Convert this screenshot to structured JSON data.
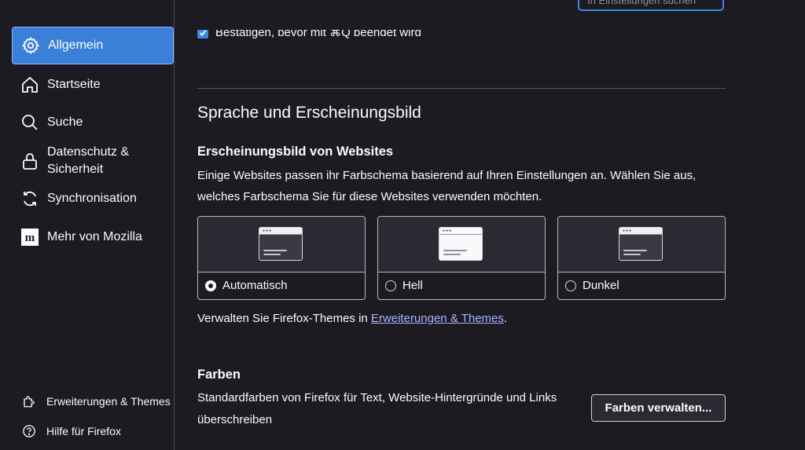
{
  "sidebar": {
    "items": [
      {
        "label": "Allgemein",
        "icon": "gear-icon",
        "selected": true
      },
      {
        "label": "Startseite",
        "icon": "home-icon"
      },
      {
        "label": "Suche",
        "icon": "search-icon"
      },
      {
        "label": "Datenschutz & Sicherheit",
        "line1": "Datenschutz &",
        "line2": "Sicherheit",
        "icon": "lock-icon"
      },
      {
        "label": "Synchronisation",
        "icon": "sync-icon"
      },
      {
        "label": "Mehr von Mozilla",
        "icon": "mozilla-icon"
      }
    ],
    "footer": [
      {
        "label": "Erweiterungen & Themes",
        "icon": "puzzle-icon"
      },
      {
        "label": "Hilfe für Firefox",
        "icon": "help-icon"
      }
    ]
  },
  "search": {
    "placeholder": "In Einstellungen suchen"
  },
  "general": {
    "confirm_quit": {
      "label": "Bestätigen, bevor mit ⌘Q beendet wird",
      "checked": true
    }
  },
  "language_section": {
    "title": "Sprache und Erscheinungsbild",
    "website_appearance": {
      "title": "Erscheinungsbild von Websites",
      "description": "Einige Websites passen ihr Farbschema basierend auf Ihren Einstellungen an. Wählen Sie aus, welches Farbschema Sie für diese Websites verwenden möchten.",
      "options": [
        {
          "label": "Automatisch",
          "selected": true,
          "preview": "dark"
        },
        {
          "label": "Hell",
          "selected": false,
          "preview": "light"
        },
        {
          "label": "Dunkel",
          "selected": false,
          "preview": "dark"
        }
      ],
      "themes_prefix": "Verwalten Sie Firefox-Themes in ",
      "themes_link": "Erweiterungen & Themes",
      "themes_suffix": "."
    }
  },
  "colors_section": {
    "title": "Farben",
    "description": "Standardfarben von Firefox für Text, Website-Hintergründe und Links überschreiben",
    "button_label": "Farben verwalten..."
  },
  "colors": {
    "accent": "#3f86e3",
    "background": "#1c1b22",
    "link": "#a8b4ff"
  }
}
